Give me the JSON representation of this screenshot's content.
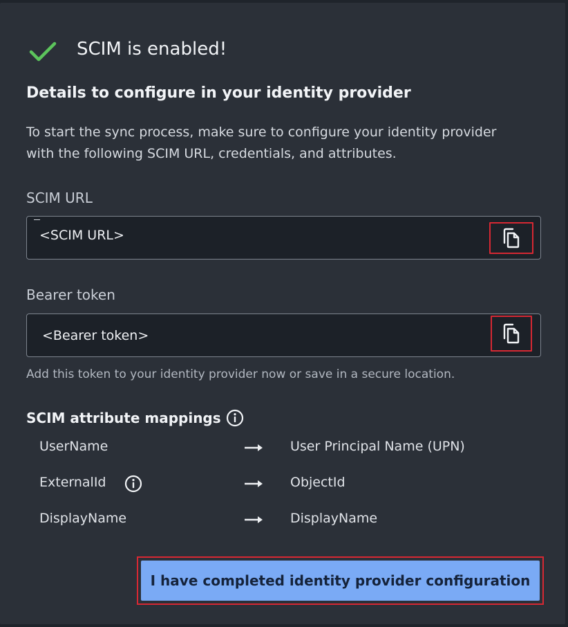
{
  "header": {
    "title": "SCIM is enabled!",
    "success_icon": "checkmark-icon",
    "success_color": "#5cc45c"
  },
  "details": {
    "heading": "Details to configure in your identity provider",
    "description": "To start the sync process, make sure to configure your identity provider with the following SCIM URL, credentials, and attributes."
  },
  "scim_url": {
    "label": "SCIM URL",
    "value": "<SCIM URL>",
    "copy_icon": "copy-icon"
  },
  "bearer_token": {
    "label": "Bearer token",
    "value": "<Bearer token>",
    "copy_icon": "copy-icon",
    "hint": "Add this token to your identity provider now or save in a secure location."
  },
  "mappings": {
    "heading": "SCIM attribute mappings",
    "rows": [
      {
        "source": "UserName",
        "target": "User Principal Name (UPN)"
      },
      {
        "source": "ExternalId",
        "target": "ObjectId"
      },
      {
        "source": "DisplayName",
        "target": "DisplayName"
      }
    ]
  },
  "footer": {
    "confirm_label": "I have completed identity provider configuration",
    "accent": "#7aaaf5"
  }
}
